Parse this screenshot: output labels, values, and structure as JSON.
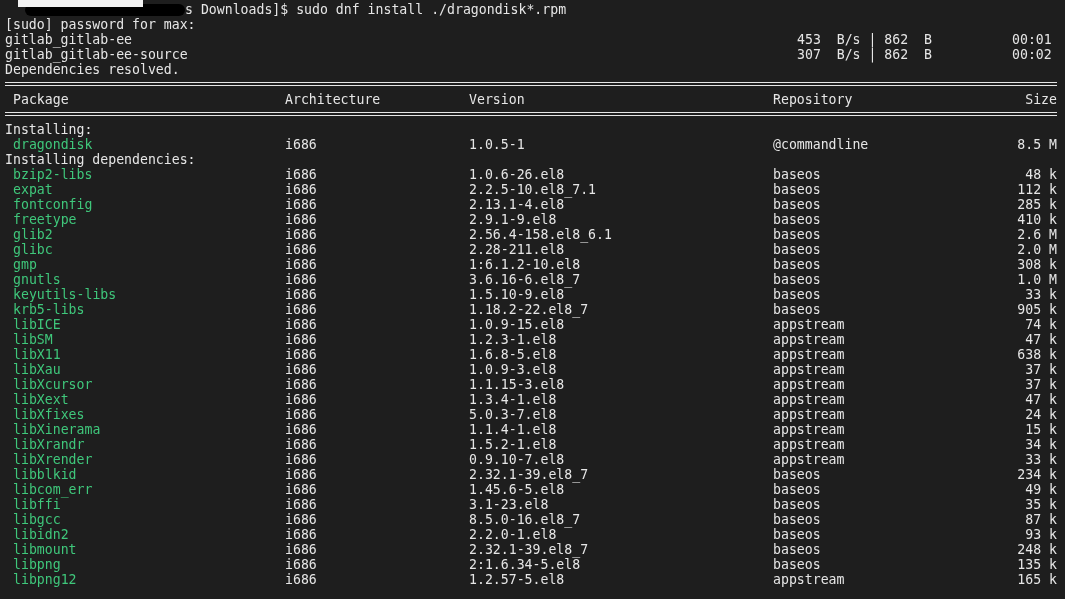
{
  "prompt": {
    "command": "s Downloads]$ sudo dnf install ./dragondisk*.rpm"
  },
  "output_lines": [
    "[sudo] password for max:"
  ],
  "repo_syncs": [
    {
      "name": "gitlab_gitlab-ee",
      "speed": "453  B/s | 862  B",
      "time": "00:01"
    },
    {
      "name": "gitlab_gitlab-ee-source",
      "speed": "307  B/s | 862  B",
      "time": "00:02"
    }
  ],
  "status": "Dependencies resolved.",
  "table": {
    "columns": [
      "Package",
      "Architecture",
      "Version",
      "Repository",
      "Size"
    ],
    "rows": [
      {
        "kind": "section",
        "label": "Installing:"
      },
      {
        "kind": "package",
        "cells": [
          "dragondisk",
          "i686",
          "1.0.5-1",
          "@commandline",
          "8.5 M"
        ]
      },
      {
        "kind": "section",
        "label": "Installing dependencies:"
      },
      {
        "kind": "package",
        "cells": [
          "bzip2-libs",
          "i686",
          "1.0.6-26.el8",
          "baseos",
          "48 k"
        ]
      },
      {
        "kind": "package",
        "cells": [
          "expat",
          "i686",
          "2.2.5-10.el8_7.1",
          "baseos",
          "112 k"
        ]
      },
      {
        "kind": "package",
        "cells": [
          "fontconfig",
          "i686",
          "2.13.1-4.el8",
          "baseos",
          "285 k"
        ]
      },
      {
        "kind": "package",
        "cells": [
          "freetype",
          "i686",
          "2.9.1-9.el8",
          "baseos",
          "410 k"
        ]
      },
      {
        "kind": "package",
        "cells": [
          "glib2",
          "i686",
          "2.56.4-158.el8_6.1",
          "baseos",
          "2.6 M"
        ]
      },
      {
        "kind": "package",
        "cells": [
          "glibc",
          "i686",
          "2.28-211.el8",
          "baseos",
          "2.0 M"
        ]
      },
      {
        "kind": "package",
        "cells": [
          "gmp",
          "i686",
          "1:6.1.2-10.el8",
          "baseos",
          "308 k"
        ]
      },
      {
        "kind": "package",
        "cells": [
          "gnutls",
          "i686",
          "3.6.16-6.el8_7",
          "baseos",
          "1.0 M"
        ]
      },
      {
        "kind": "package",
        "cells": [
          "keyutils-libs",
          "i686",
          "1.5.10-9.el8",
          "baseos",
          "33 k"
        ]
      },
      {
        "kind": "package",
        "cells": [
          "krb5-libs",
          "i686",
          "1.18.2-22.el8_7",
          "baseos",
          "905 k"
        ]
      },
      {
        "kind": "package",
        "cells": [
          "libICE",
          "i686",
          "1.0.9-15.el8",
          "appstream",
          "74 k"
        ]
      },
      {
        "kind": "package",
        "cells": [
          "libSM",
          "i686",
          "1.2.3-1.el8",
          "appstream",
          "47 k"
        ]
      },
      {
        "kind": "package",
        "cells": [
          "libX11",
          "i686",
          "1.6.8-5.el8",
          "appstream",
          "638 k"
        ]
      },
      {
        "kind": "package",
        "cells": [
          "libXau",
          "i686",
          "1.0.9-3.el8",
          "appstream",
          "37 k"
        ]
      },
      {
        "kind": "package",
        "cells": [
          "libXcursor",
          "i686",
          "1.1.15-3.el8",
          "appstream",
          "37 k"
        ]
      },
      {
        "kind": "package",
        "cells": [
          "libXext",
          "i686",
          "1.3.4-1.el8",
          "appstream",
          "47 k"
        ]
      },
      {
        "kind": "package",
        "cells": [
          "libXfixes",
          "i686",
          "5.0.3-7.el8",
          "appstream",
          "24 k"
        ]
      },
      {
        "kind": "package",
        "cells": [
          "libXinerama",
          "i686",
          "1.1.4-1.el8",
          "appstream",
          "15 k"
        ]
      },
      {
        "kind": "package",
        "cells": [
          "libXrandr",
          "i686",
          "1.5.2-1.el8",
          "appstream",
          "34 k"
        ]
      },
      {
        "kind": "package",
        "cells": [
          "libXrender",
          "i686",
          "0.9.10-7.el8",
          "appstream",
          "33 k"
        ]
      },
      {
        "kind": "package",
        "cells": [
          "libblkid",
          "i686",
          "2.32.1-39.el8_7",
          "baseos",
          "234 k"
        ]
      },
      {
        "kind": "package",
        "cells": [
          "libcom_err",
          "i686",
          "1.45.6-5.el8",
          "baseos",
          "49 k"
        ]
      },
      {
        "kind": "package",
        "cells": [
          "libffi",
          "i686",
          "3.1-23.el8",
          "baseos",
          "35 k"
        ]
      },
      {
        "kind": "package",
        "cells": [
          "libgcc",
          "i686",
          "8.5.0-16.el8_7",
          "baseos",
          "87 k"
        ]
      },
      {
        "kind": "package",
        "cells": [
          "libidn2",
          "i686",
          "2.2.0-1.el8",
          "baseos",
          "93 k"
        ]
      },
      {
        "kind": "package",
        "cells": [
          "libmount",
          "i686",
          "2.32.1-39.el8_7",
          "baseos",
          "248 k"
        ]
      },
      {
        "kind": "package",
        "cells": [
          "libpng",
          "i686",
          "2:1.6.34-5.el8",
          "baseos",
          "135 k"
        ]
      },
      {
        "kind": "package",
        "cells": [
          "libpng12",
          "i686",
          "1.2.57-5.el8",
          "appstream",
          "165 k"
        ]
      }
    ]
  }
}
